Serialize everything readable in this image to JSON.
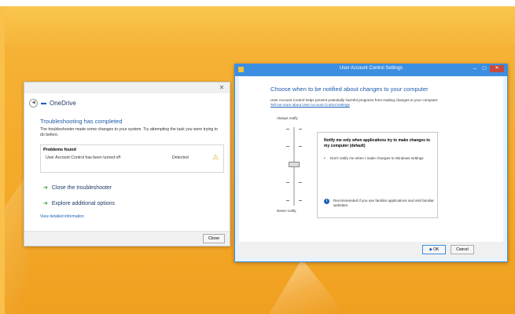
{
  "troubleshooter": {
    "app_name": "OneDrive",
    "heading": "Troubleshooting has completed",
    "description": "The troubleshooter made some changes to your system. Try attempting the task you were trying to do before.",
    "problems_title": "Problems found",
    "problem_text": "User Account Control has been turned off",
    "problem_status": "Detected",
    "close_troubleshooter": "Close the troubleshooter",
    "explore_options": "Explore additional options",
    "detail_link": "View detailed information",
    "close_button": "Close"
  },
  "uac": {
    "title": "User Account Control Settings",
    "heading": "Choose when to be notified about changes to your computer",
    "description": "User Account Control helps prevent potentially harmful programs from making changes to your computer.",
    "learn_more": "Tell me more about User Account Control settings",
    "always_notify": "Always notify",
    "never_notify": "Never notify",
    "slider_level": 2,
    "slider_levels": 4,
    "panel_title": "Notify me only when applications try to make changes to my computer (default)",
    "panel_bullet": "Don't notify me when I make changes to Windows settings",
    "panel_info": "Recommended if you use familiar applications and visit familiar websites.",
    "ok_button": "OK",
    "cancel_button": "Cancel"
  },
  "colors": {
    "accent": "#3c8fe0",
    "wallpaper": "#f4aa2a",
    "link": "#1c5fb7"
  }
}
